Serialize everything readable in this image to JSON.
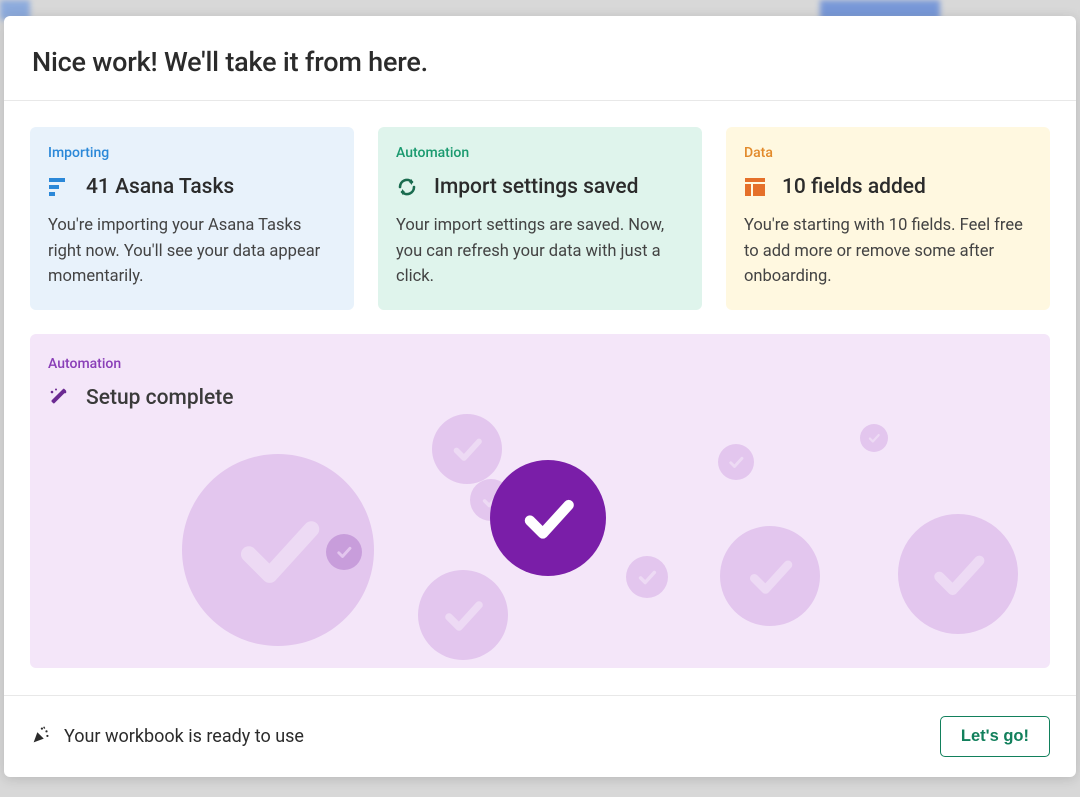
{
  "header": {
    "title": "Nice work! We'll take it from here."
  },
  "cards": {
    "importing": {
      "label": "Importing",
      "heading": "41 Asana Tasks",
      "desc": "You're importing your Asana Tasks right now. You'll see your data appear momentarily."
    },
    "automation": {
      "label": "Automation",
      "heading": "Import settings saved",
      "desc": "Your import settings are saved. Now, you can refresh your data with just a click."
    },
    "data": {
      "label": "Data",
      "heading": "10 fields added",
      "desc": "You're starting with 10 fields. Feel free to add more or remove some after onboarding."
    }
  },
  "setup": {
    "label": "Automation",
    "heading": "Setup complete"
  },
  "footer": {
    "ready_text": "Your workbook is ready to use",
    "go_label": "Let's go!"
  }
}
